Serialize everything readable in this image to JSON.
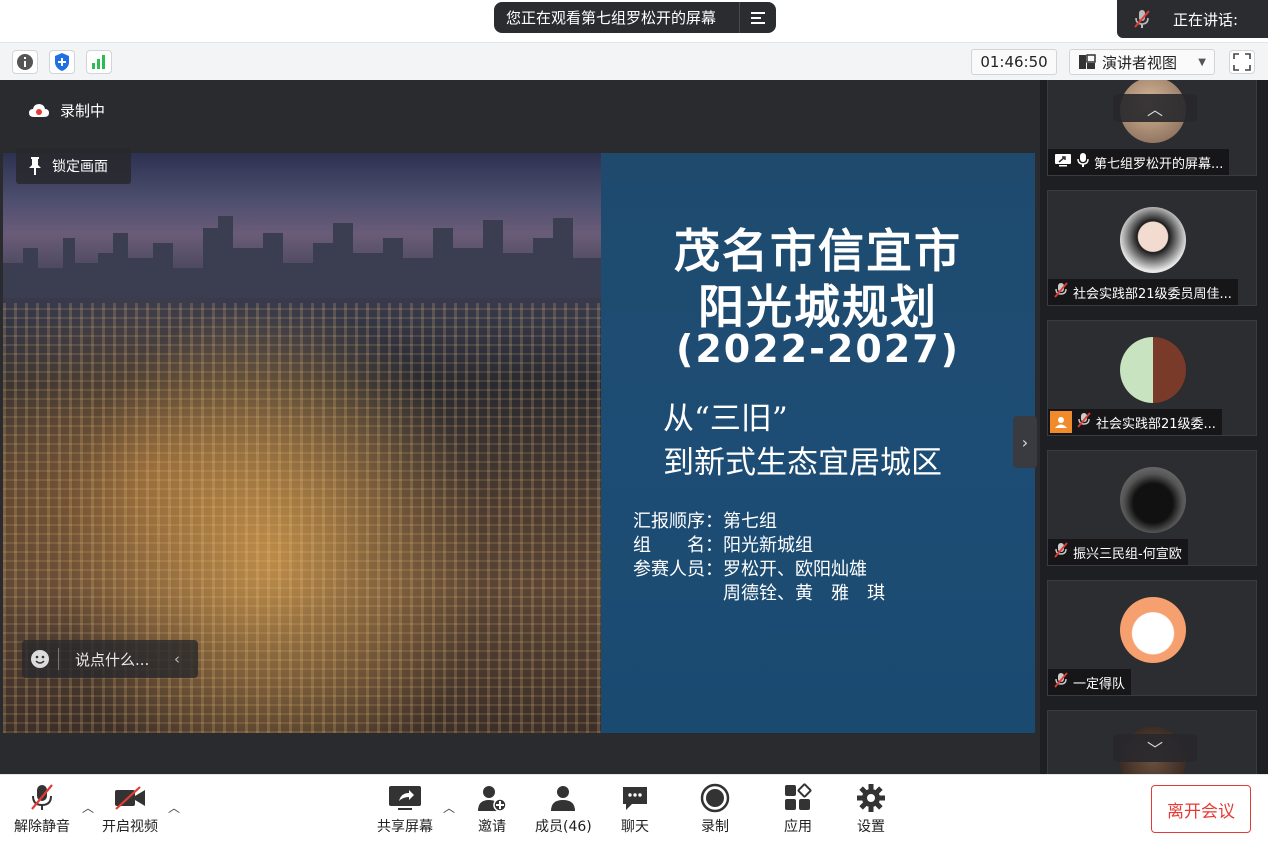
{
  "top": {
    "viewing_text": "您正在观看第七组罗松开的屏幕",
    "speaking_label": "正在讲话:"
  },
  "toolbar": {
    "timer": "01:46:50",
    "view_mode": "演讲者视图"
  },
  "stage": {
    "recording_label": "录制中",
    "lock_label": "锁定画面",
    "chat_placeholder": "说点什么..."
  },
  "slide": {
    "title_line1": "茂名市信宜市",
    "title_line2": "阳光城规划",
    "years": "(2022-2027)",
    "subtitle_line1": "从“三旧”",
    "subtitle_line2": "到新式生态宜居城区",
    "info_line1": "汇报顺序：第七组",
    "info_line2": "组　　名：阳光新城组",
    "info_line3": "参赛人员：罗松开、欧阳灿雄",
    "info_line4": "　　　　　周德铨、黄　雅　琪"
  },
  "participants": [
    {
      "name": "第七组罗松开的屏幕...",
      "muted": false,
      "sharing": true
    },
    {
      "name": "社会实践部21级委员周佳...",
      "muted": true
    },
    {
      "name": "社会实践部21级委...",
      "muted": true,
      "host_badge": true
    },
    {
      "name": "振兴三民组-何宣欧",
      "muted": true
    },
    {
      "name": "一定得队",
      "muted": true
    }
  ],
  "bottombar": {
    "unmute": "解除静音",
    "start_video": "开启视频",
    "share_screen": "共享屏幕",
    "invite": "邀请",
    "members": "成员(46)",
    "chat": "聊天",
    "record": "录制",
    "apps": "应用",
    "settings": "设置",
    "leave": "离开会议"
  },
  "colors": {
    "leave_red": "#e33b36",
    "slide_blue": "#1d4d74",
    "dark_bg": "#2a2b2e"
  }
}
